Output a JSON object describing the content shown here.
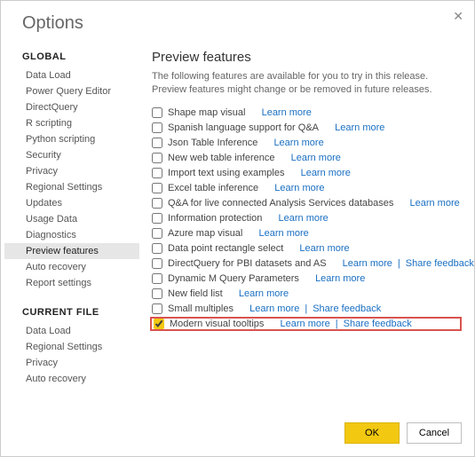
{
  "dialog": {
    "title": "Options"
  },
  "sidebar": {
    "sections": [
      {
        "header": "GLOBAL",
        "items": [
          {
            "label": "Data Load"
          },
          {
            "label": "Power Query Editor"
          },
          {
            "label": "DirectQuery"
          },
          {
            "label": "R scripting"
          },
          {
            "label": "Python scripting"
          },
          {
            "label": "Security"
          },
          {
            "label": "Privacy"
          },
          {
            "label": "Regional Settings"
          },
          {
            "label": "Updates"
          },
          {
            "label": "Usage Data"
          },
          {
            "label": "Diagnostics"
          },
          {
            "label": "Preview features",
            "selected": true
          },
          {
            "label": "Auto recovery"
          },
          {
            "label": "Report settings"
          }
        ]
      },
      {
        "header": "CURRENT FILE",
        "items": [
          {
            "label": "Data Load"
          },
          {
            "label": "Regional Settings"
          },
          {
            "label": "Privacy"
          },
          {
            "label": "Auto recovery"
          }
        ]
      }
    ]
  },
  "content": {
    "heading": "Preview features",
    "desc": "The following features are available for you to try in this release. Preview features might change or be removed in future releases.",
    "link_learn": "Learn more",
    "link_share": "Share feedback",
    "sep": "|",
    "features": [
      {
        "label": "Shape map visual"
      },
      {
        "label": "Spanish language support for Q&A"
      },
      {
        "label": "Json Table Inference"
      },
      {
        "label": "New web table inference"
      },
      {
        "label": "Import text using examples"
      },
      {
        "label": "Excel table inference"
      },
      {
        "label": "Q&A for live connected Analysis Services databases"
      },
      {
        "label": "Information protection"
      },
      {
        "label": "Azure map visual"
      },
      {
        "label": "Data point rectangle select"
      },
      {
        "label": "DirectQuery for PBI datasets and AS",
        "share": true
      },
      {
        "label": "Dynamic M Query Parameters"
      },
      {
        "label": "New field list"
      },
      {
        "label": "Small multiples",
        "share": true
      },
      {
        "label": "Modern visual tooltips",
        "share": true,
        "checked": true,
        "highlight": true
      }
    ]
  },
  "footer": {
    "ok": "OK",
    "cancel": "Cancel"
  }
}
